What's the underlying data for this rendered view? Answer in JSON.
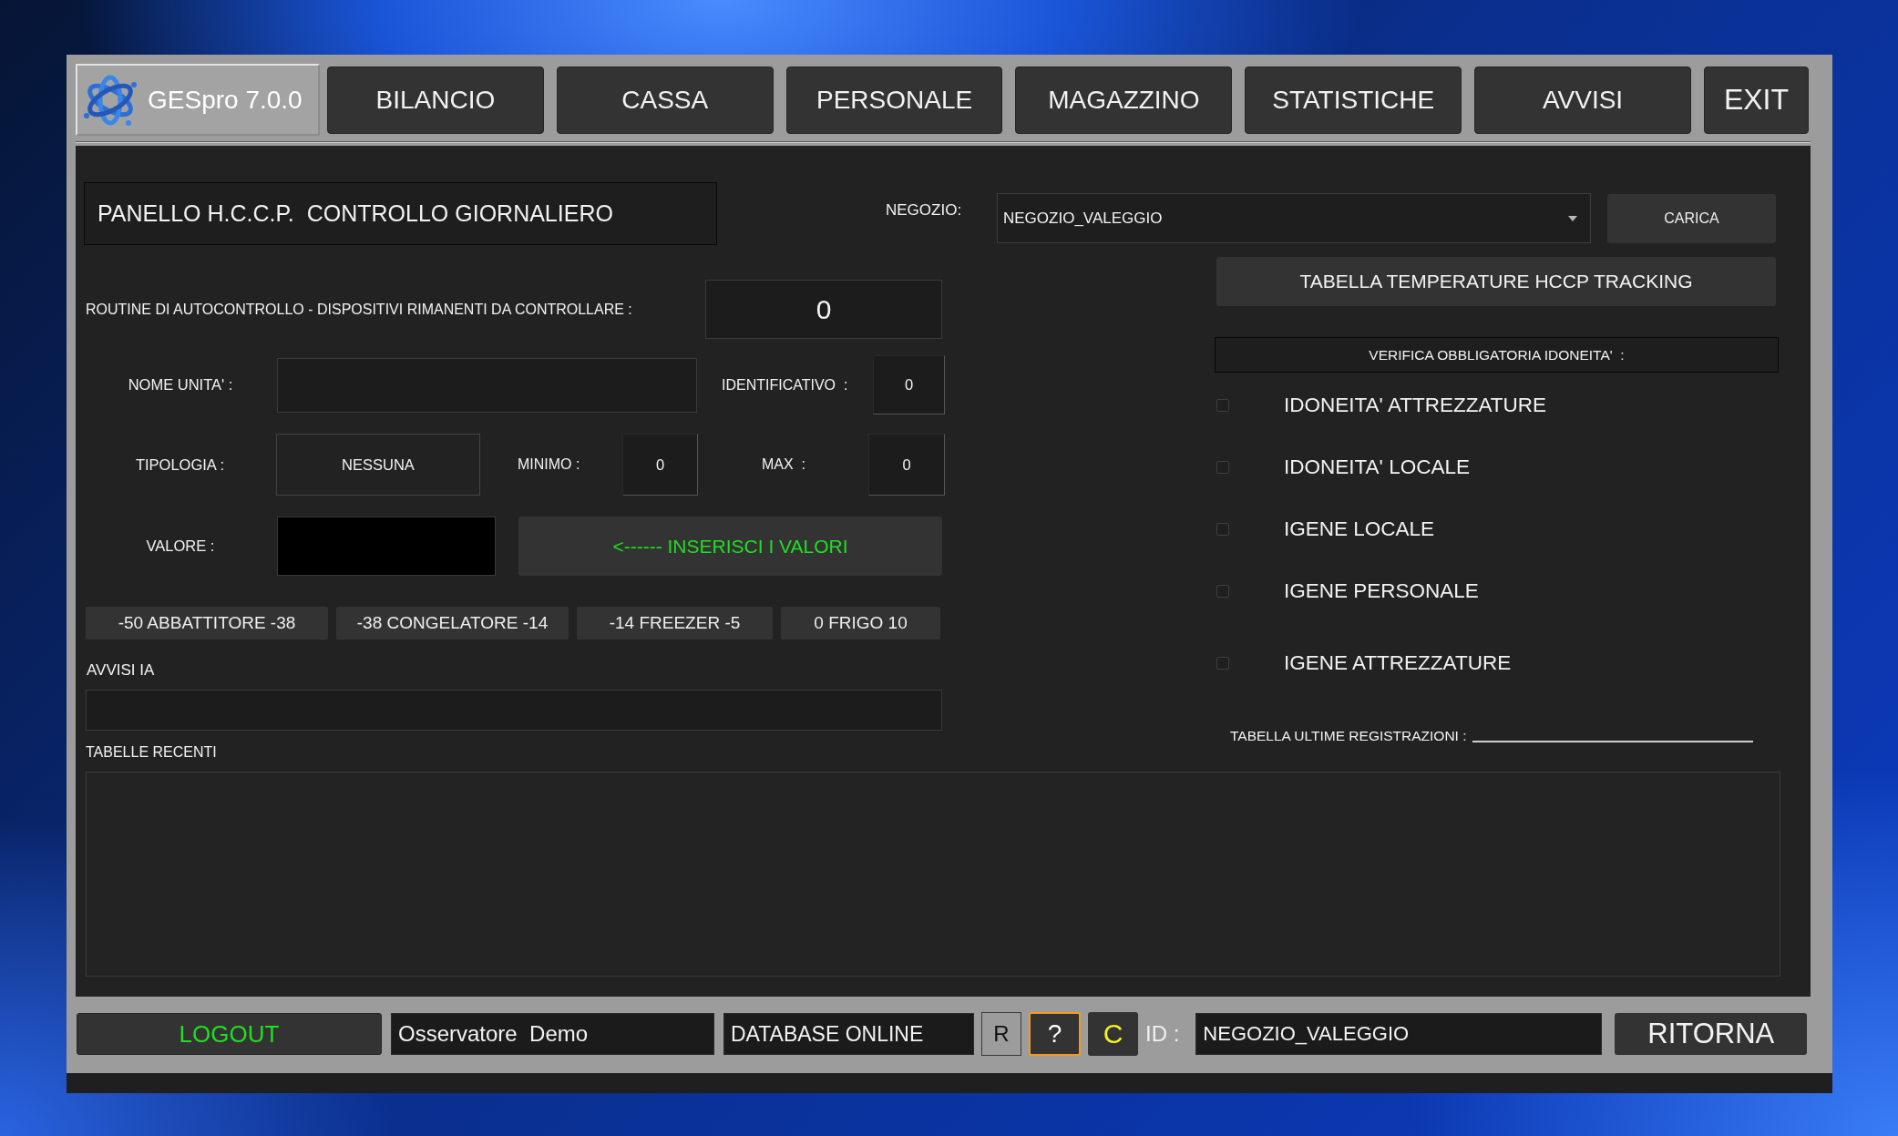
{
  "app": {
    "title": "GESpro 7.0.0"
  },
  "tabs": [
    {
      "label": "BILANCIO",
      "kind": "menu"
    },
    {
      "label": "CASSA",
      "kind": "menu"
    },
    {
      "label": "PERSONALE",
      "kind": "menu"
    },
    {
      "label": "MAGAZZINO",
      "kind": "menu"
    },
    {
      "label": "STATISTICHE",
      "kind": "menu"
    },
    {
      "label": "AVVISI",
      "kind": "menu"
    },
    {
      "label": "EXIT",
      "kind": "exit"
    }
  ],
  "panel": {
    "title": "PANELLO H.C.C.P.  CONTROLLO GIORNALIERO"
  },
  "store": {
    "label": "NEGOZIO:",
    "value": "NEGOZIO_VALEGGIO",
    "button": "CARICA"
  },
  "routine": {
    "label": "ROUTINE DI AUTOCONTROLLO - DISPOSITIVI RIMANENTI DA CONTROLLARE :",
    "count": "0"
  },
  "unit_name": {
    "label": "NOME UNITA' :"
  },
  "identifier": {
    "label": "IDENTIFICATIVO  :",
    "value": "0"
  },
  "type": {
    "label": "TIPOLOGIA :",
    "value": "NESSUNA"
  },
  "minimum": {
    "label": "MINIMO :",
    "value": "0"
  },
  "maximum": {
    "label": "MAX  :",
    "value": "0"
  },
  "reading": {
    "label": "VALORE :"
  },
  "insert_button": "<------ INSERISCI I VALORI",
  "ranges": [
    "-50 ABBATTITORE -38",
    "-38 CONGELATORE -14",
    "-14 FREEZER -5",
    "0 FRIGO 10"
  ],
  "ai_alerts": {
    "label": "AVVISI IA"
  },
  "recent_tables": {
    "label": "TABELLE RECENTI"
  },
  "temperature_button": "TABELLA TEMPERATURE HCCP TRACKING",
  "checks": {
    "title": "VERIFICA OBBLIGATORIA IDONEITA'  :",
    "items": [
      {
        "label": "IDONEITA' ATTREZZATURE",
        "checked": false
      },
      {
        "label": "IDONEITA' LOCALE",
        "checked": false
      },
      {
        "label": "IGENE LOCALE",
        "checked": false
      },
      {
        "label": "IGENE PERSONALE",
        "checked": false
      },
      {
        "label": "IGENE ATTREZZATURE",
        "checked": false
      }
    ]
  },
  "last_records": {
    "label": "TABELLA ULTIME REGISTRAZIONI :"
  },
  "status_bar": {
    "logout": "LOGOUT",
    "user": "Osservatore  Demo",
    "database": "DATABASE ONLINE",
    "tools": [
      {
        "label": "R",
        "kind": "flat"
      },
      {
        "label": "?",
        "kind": "help"
      },
      {
        "label": "C",
        "kind": "accent"
      }
    ],
    "id_label": "ID :",
    "id_value": "NEGOZIO_VALEGGIO",
    "back": "RITORNA"
  }
}
